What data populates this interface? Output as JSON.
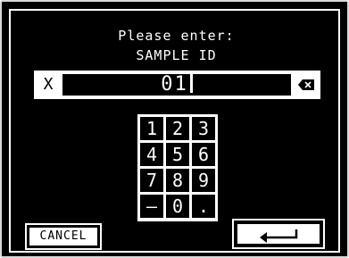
{
  "prompt": {
    "line1": "Please enter:",
    "line2": "SAMPLE ID"
  },
  "input": {
    "value": "01",
    "clear_label": "X",
    "backspace_icon": "backspace-icon"
  },
  "keypad": {
    "keys": [
      "1",
      "2",
      "3",
      "4",
      "5",
      "6",
      "7",
      "8",
      "9",
      "–",
      "0",
      "."
    ]
  },
  "buttons": {
    "cancel_label": "CANCEL",
    "enter_icon": "enter-arrow-icon"
  },
  "colors": {
    "background": "#000000",
    "foreground": "#ffffff"
  }
}
